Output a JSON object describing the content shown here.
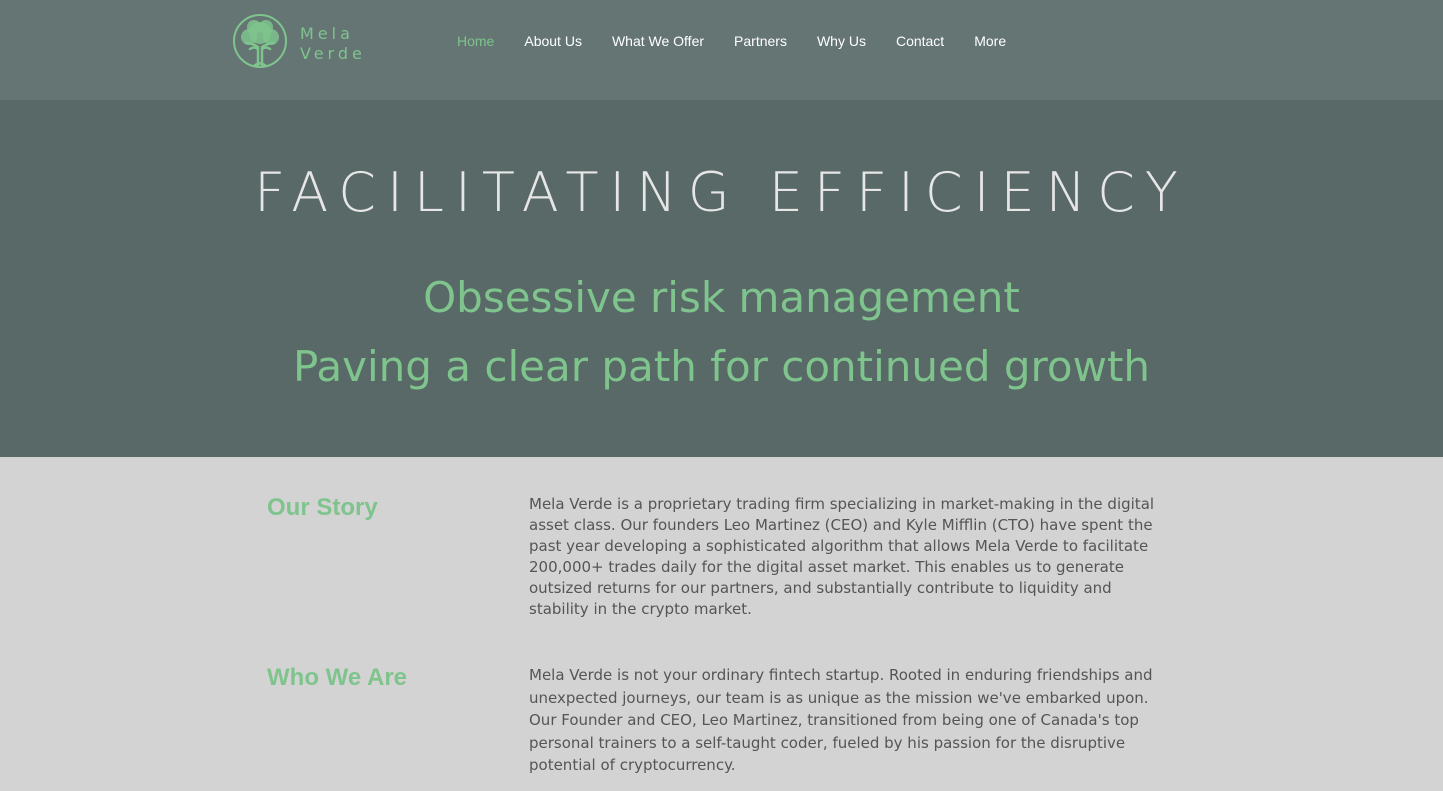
{
  "brand": {
    "name_line1": "Mela",
    "name_line2": "Verde",
    "logo_icon": "tree-icon",
    "accent_color": "#7fc48d"
  },
  "nav": {
    "items": [
      {
        "label": "Home",
        "active": true
      },
      {
        "label": "About Us"
      },
      {
        "label": "What We Offer"
      },
      {
        "label": "Partners"
      },
      {
        "label": "Why Us"
      },
      {
        "label": "Contact"
      },
      {
        "label": "More"
      }
    ]
  },
  "hero": {
    "title": "FACILITATING EFFICIENCY",
    "subtitle_line1": "Obsessive risk management",
    "subtitle_line2": "Paving a clear path for continued growth"
  },
  "sections": [
    {
      "title": "Our Story",
      "body": "Mela Verde is a proprietary trading firm specializing in market-making in the digital asset class. Our founders Leo Martinez (CEO) and Kyle Mifflin (CTO) have spent the past year developing a sophisticated algorithm that allows Mela Verde to facilitate 200,000+ trades daily for the digital asset market. This enables us to generate outsized returns for our partners, and substantially contribute to liquidity and stability in the crypto market."
    },
    {
      "title": "Who We Are",
      "body": "Mela Verde is not your ordinary fintech startup. Rooted in enduring friendships and unexpected journeys, our team is as unique as the mission we've embarked upon. Our Founder and CEO, Leo Martinez, transitioned from being one of Canada's top personal trainers to a self-taught coder, fueled by his passion for the disruptive potential of cryptocurrency."
    }
  ]
}
